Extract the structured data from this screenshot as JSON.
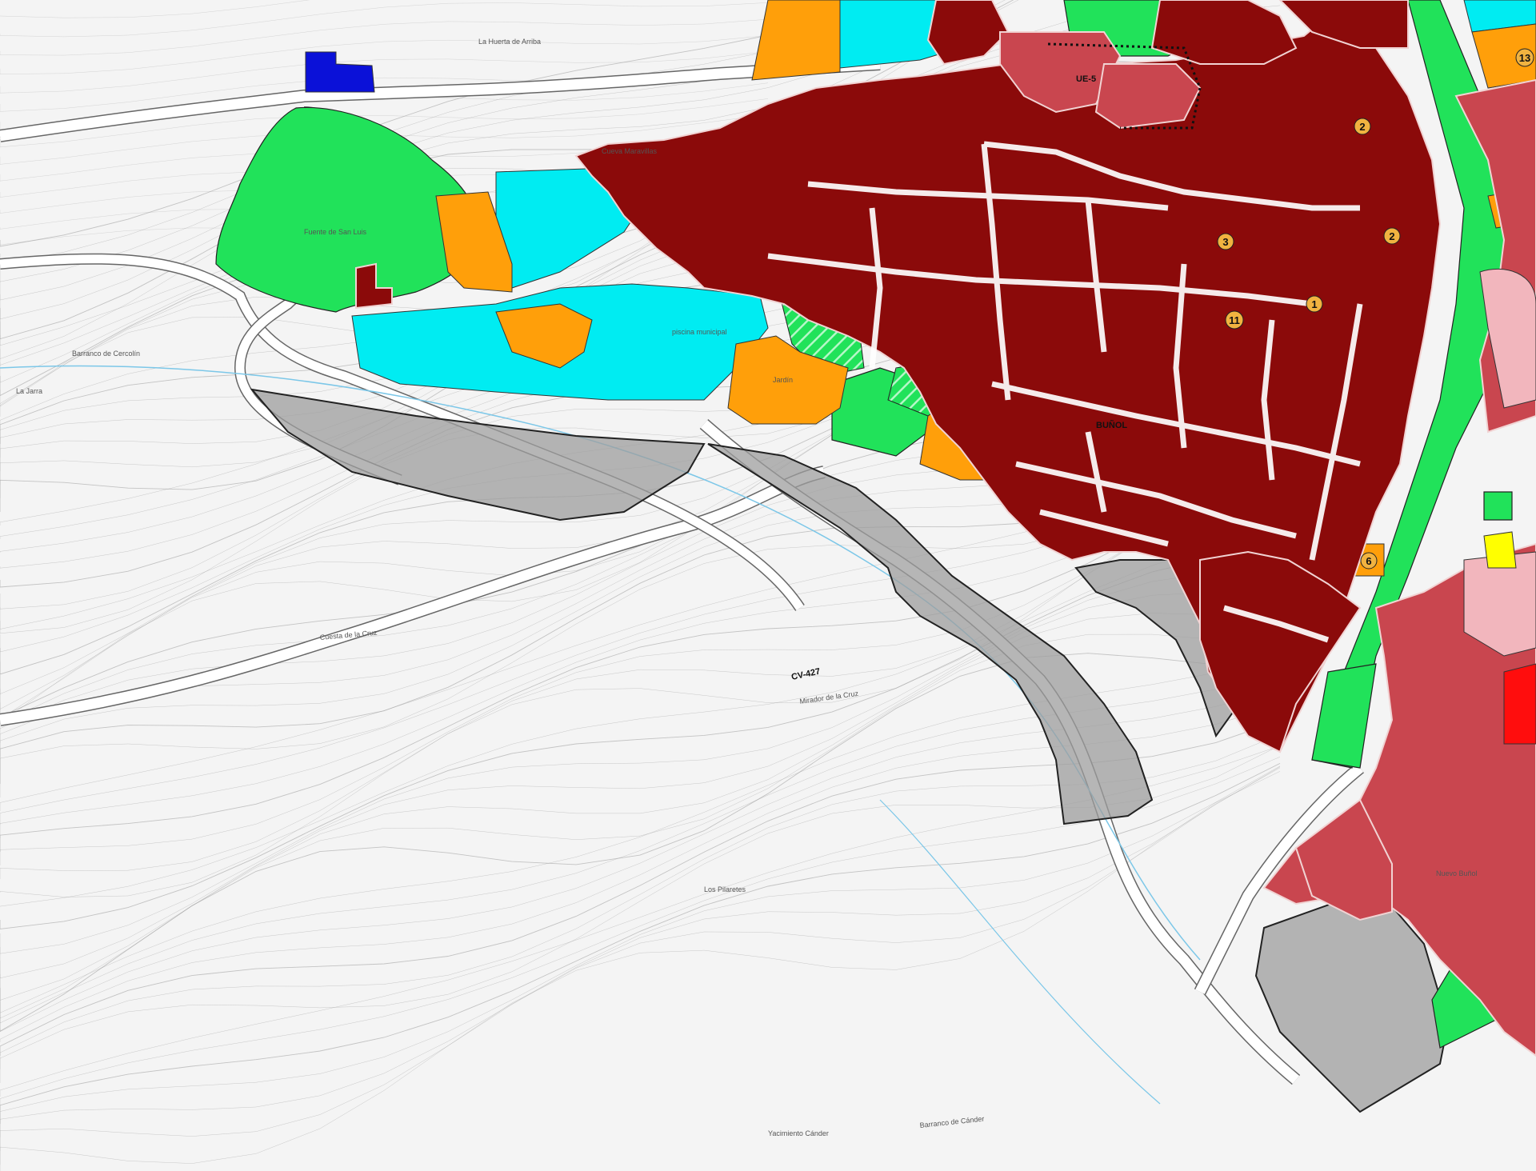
{
  "colors": {
    "background": "#f4f4f4",
    "contour": "#9a9a9a",
    "road": "#ffffff",
    "road_edge": "#555555",
    "urban_core": "#8b0a0a",
    "urban_expansion": "#c9464f",
    "green_space": "#21e25a",
    "equipment": "#ff9f0a",
    "sports": "#00ecf2",
    "protected": "#9d9d9d",
    "pink_zone": "#f2b6bd",
    "red_zone": "#ff0d0d",
    "yellow_zone": "#ffff00",
    "blue_zone": "#0b11d8"
  },
  "labels": {
    "ue5": "UE-5",
    "town": "BUÑOL",
    "road": "CV-427",
    "huerta": "La Huerta de Arriba",
    "cueva": "Cueva Maravillas",
    "jarra": "La Jarra",
    "barranco_cercolin": "Barranco de Cercolín",
    "cuesta": "Cuesta de la Cruz",
    "pilaretes": "Los Pilaretes",
    "barranco_cander": "Barranco de Cánder",
    "yacimiento": "Yacimiento Cánder",
    "nuevo": "Nuevo Buñol",
    "piscina": "piscina municipal",
    "jardin": "Jardín",
    "mirador": "Mirador de la Cruz",
    "fuente": "Fuente de San Luis"
  },
  "markers": [
    "2",
    "2",
    "3",
    "1",
    "11",
    "6",
    "13"
  ]
}
